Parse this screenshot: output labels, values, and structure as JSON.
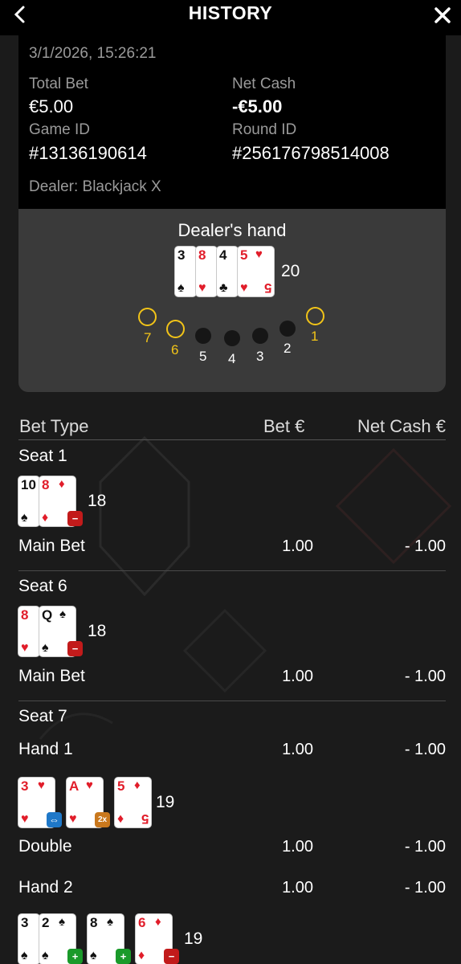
{
  "header": {
    "title": "HISTORY"
  },
  "summary": {
    "datetime": "3/1/2026, 15:26:21",
    "total_bet_label": "Total Bet",
    "total_bet": "€5.00",
    "net_cash_label": "Net Cash",
    "net_cash": "-€5.00",
    "game_id_label": "Game ID",
    "game_id": "#13136190614",
    "round_id_label": "Round ID",
    "round_id": "#256176798514008",
    "dealer": "Dealer: Blackjack X"
  },
  "dealer_hand": {
    "title": "Dealer's hand",
    "score": "20",
    "cards": [
      {
        "rank": "3",
        "suit": "♠",
        "color": "black"
      },
      {
        "rank": "8",
        "suit": "♥",
        "color": "red"
      },
      {
        "rank": "4",
        "suit": "♣",
        "color": "black"
      },
      {
        "rank": "5",
        "suit": "♥",
        "color": "red"
      }
    ],
    "seats": [
      "7",
      "6",
      "5",
      "4",
      "3",
      "2",
      "1"
    ]
  },
  "table": {
    "col_bet_type": "Bet Type",
    "col_bet": "Bet €",
    "col_net": "Net Cash €"
  },
  "seat1": {
    "label": "Seat 1",
    "score": "18",
    "cards": [
      {
        "rank": "10",
        "suit": "♠",
        "color": "black"
      },
      {
        "rank": "8",
        "suit": "♦",
        "color": "red"
      }
    ],
    "bet_label": "Main Bet",
    "bet": "1.00",
    "net": "- 1.00"
  },
  "seat6": {
    "label": "Seat 6",
    "score": "18",
    "cards": [
      {
        "rank": "8",
        "suit": "♥",
        "color": "red"
      },
      {
        "rank": "Q",
        "suit": "♠",
        "color": "black"
      }
    ],
    "bet_label": "Main Bet",
    "bet": "1.00",
    "net": "- 1.00"
  },
  "seat7": {
    "label": "Seat 7",
    "hand1": {
      "label": "Hand 1",
      "bet": "1.00",
      "net": "- 1.00",
      "score": "19",
      "cards": [
        {
          "rank": "3",
          "suit": "♥",
          "color": "red"
        },
        {
          "rank": "A",
          "suit": "♥",
          "color": "red"
        },
        {
          "rank": "5",
          "suit": "♦",
          "color": "red"
        }
      ],
      "double_label": "Double",
      "double_bet": "1.00",
      "double_net": "- 1.00",
      "badge_double": "2x"
    },
    "hand2": {
      "label": "Hand 2",
      "bet": "1.00",
      "net": "- 1.00",
      "score": "19",
      "cards": [
        {
          "rank": "3",
          "suit": "♠",
          "color": "black"
        },
        {
          "rank": "2",
          "suit": "♠",
          "color": "black"
        },
        {
          "rank": "8",
          "suit": "♠",
          "color": "black"
        },
        {
          "rank": "6",
          "suit": "♦",
          "color": "red"
        }
      ]
    }
  },
  "colors": {
    "background": "#1b1b1b",
    "panel": "#3a3a3a",
    "gold": "#f2c418",
    "red": "#e11d2a"
  }
}
